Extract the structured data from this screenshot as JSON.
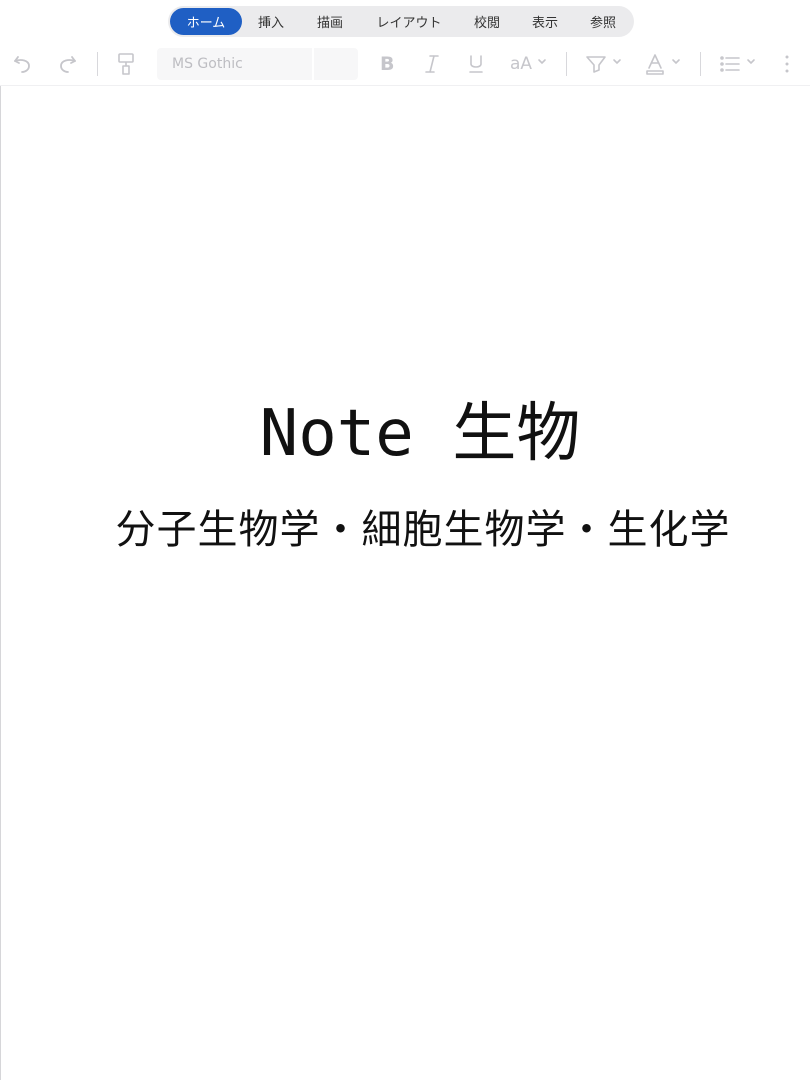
{
  "tabs": [
    {
      "label": "ホーム",
      "active": true
    },
    {
      "label": "挿入",
      "active": false
    },
    {
      "label": "描画",
      "active": false
    },
    {
      "label": "レイアウト",
      "active": false
    },
    {
      "label": "校閲",
      "active": false
    },
    {
      "label": "表示",
      "active": false
    },
    {
      "label": "参照",
      "active": false
    }
  ],
  "toolbar": {
    "font_name": "MS Gothic",
    "font_size": "",
    "text_size_label": "aA",
    "icons": [
      "undo-icon",
      "redo-icon",
      "format-painter-icon",
      "bold-icon",
      "italic-icon",
      "underline-icon",
      "text-size-icon",
      "highlight-icon",
      "font-color-icon",
      "bullet-list-icon",
      "more-icon"
    ],
    "colors": {
      "active_tab": "#1f5fc4",
      "icon_disabled": "#c6c6cb"
    }
  },
  "document": {
    "title": "Note 生物",
    "subtitle": "分子生物学・細胞生物学・生化学"
  }
}
